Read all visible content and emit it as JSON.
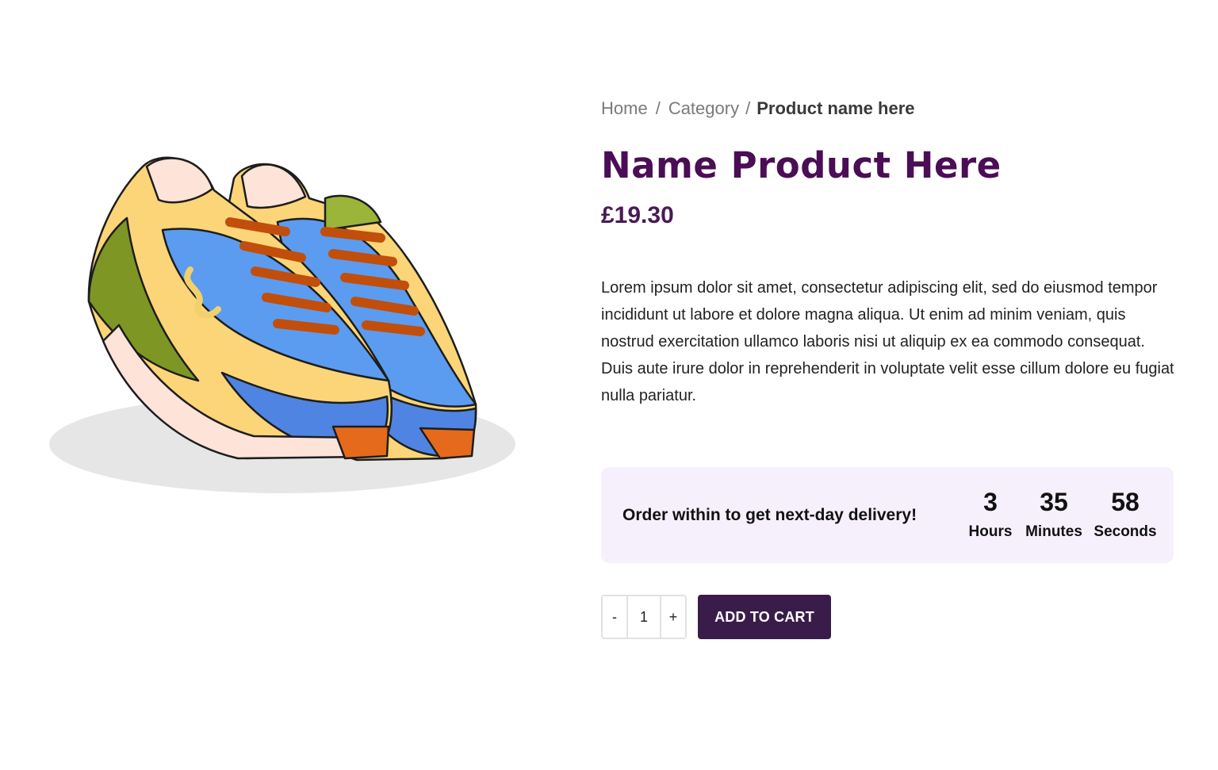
{
  "breadcrumb": {
    "home": "Home",
    "category": "Category",
    "current": "Product name here",
    "separator": "/"
  },
  "product": {
    "title": "Name Product Here",
    "price": "£19.30",
    "description": "Lorem ipsum dolor sit amet, consectetur adipiscing elit, sed do eiusmod tempor incididunt ut labore et dolore magna aliqua. Ut enim ad minim veniam, quis nostrud exercitation ullamco laboris nisi ut aliquip ex ea commodo consequat. Duis aute irure dolor in reprehenderit in voluptate velit esse cillum dolore eu fugiat nulla pariatur.",
    "image_icon": "sneakers-illustration"
  },
  "delivery": {
    "message": "Order within to get next-day delivery!",
    "countdown": {
      "hours": {
        "value": "3",
        "label": "Hours"
      },
      "minutes": {
        "value": "35",
        "label": "Minutes"
      },
      "seconds": {
        "value": "58",
        "label": "Seconds"
      }
    }
  },
  "cart": {
    "decrement_label": "-",
    "quantity": "1",
    "increment_label": "+",
    "add_label": "ADD TO CART"
  },
  "colors": {
    "title": "#4b0d56",
    "price": "#4a1a55",
    "delivery_bg": "#f6f0fd",
    "button_bg": "#3a1c4b",
    "button_text": "#ffffff"
  }
}
